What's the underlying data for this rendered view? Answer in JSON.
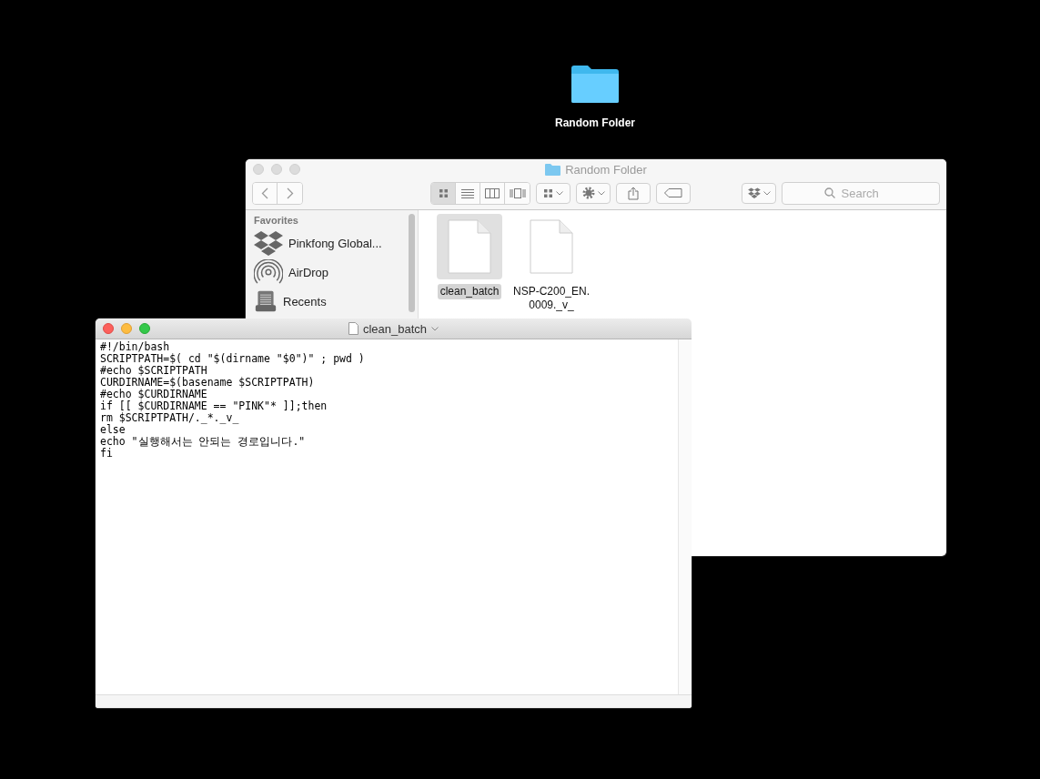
{
  "desktop_icon": {
    "label": "Random Folder"
  },
  "finder": {
    "title": "Random Folder",
    "views": [
      {
        "kind": "icons",
        "selected": true
      },
      {
        "kind": "list",
        "selected": false
      },
      {
        "kind": "columns",
        "selected": false
      },
      {
        "kind": "gallery",
        "selected": false
      }
    ],
    "search": {
      "placeholder": "Search"
    },
    "sidebar": {
      "heading": "Favorites",
      "items": [
        {
          "kind": "dropbox",
          "label": "Pinkfong Global..."
        },
        {
          "kind": "airdrop",
          "label": "AirDrop"
        },
        {
          "kind": "recents",
          "label": "Recents"
        }
      ]
    },
    "files": [
      {
        "lines": [
          "clean_batch"
        ],
        "selected": true
      },
      {
        "lines": [
          "NSP-C200_EN.",
          "0009._v_"
        ],
        "selected": false
      }
    ]
  },
  "editor": {
    "title": "clean_batch",
    "lines": [
      "#!/bin/bash",
      "SCRIPTPATH=$( cd \"$(dirname \"$0\")\" ; pwd )",
      "#echo $SCRIPTPATH",
      "CURDIRNAME=$(basename $SCRIPTPATH)",
      "#echo $CURDIRNAME",
      "if [[ $CURDIRNAME == \"PINK\"* ]];then",
      "rm $SCRIPTPATH/._*._v_",
      "else",
      "echo \"실행해서는 안되는 경로입니다.\"",
      "fi"
    ]
  }
}
